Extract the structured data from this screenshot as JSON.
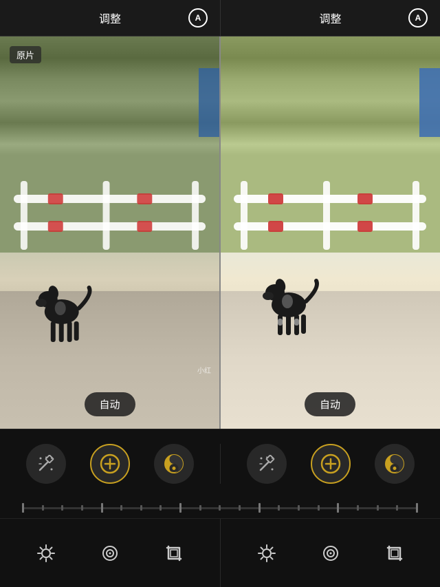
{
  "header": {
    "left": {
      "title": "调整",
      "icon_label": "A"
    },
    "right": {
      "title": "调整",
      "icon_label": "A"
    }
  },
  "image_area": {
    "original_label": "原片",
    "watermark": "小红",
    "auto_button_left": "自动",
    "auto_button_right": "自动"
  },
  "tools": {
    "left": [
      {
        "name": "wand",
        "label": "魔棒",
        "active": false,
        "symbol": "✦"
      },
      {
        "name": "plus-circle",
        "label": "加",
        "active": true,
        "symbol": "+"
      },
      {
        "name": "tone",
        "label": "色调",
        "active": false,
        "symbol": "☯"
      }
    ],
    "right": [
      {
        "name": "wand",
        "label": "魔棒",
        "active": false,
        "symbol": "✦"
      },
      {
        "name": "plus-circle",
        "label": "加",
        "active": true,
        "symbol": "+"
      },
      {
        "name": "tone",
        "label": "色调",
        "active": false,
        "symbol": "☯"
      }
    ]
  },
  "bottom_tools": {
    "left": [
      {
        "name": "brightness",
        "label": "亮度",
        "symbol": "☀"
      },
      {
        "name": "loop",
        "label": "循环",
        "symbol": "⟳"
      },
      {
        "name": "crop",
        "label": "裁剪",
        "symbol": "⊞"
      }
    ],
    "right": [
      {
        "name": "brightness",
        "label": "亮度",
        "symbol": "☀"
      },
      {
        "name": "loop",
        "label": "循环",
        "symbol": "⟳"
      },
      {
        "name": "crop",
        "label": "裁剪",
        "symbol": "⊞"
      }
    ]
  },
  "colors": {
    "accent": "#c8a020",
    "bg": "#111111",
    "header_bg": "#1a1a1a",
    "divider": "#888888",
    "icon_bg": "#282828",
    "text_primary": "#ffffff",
    "text_secondary": "#aaaaaa"
  }
}
